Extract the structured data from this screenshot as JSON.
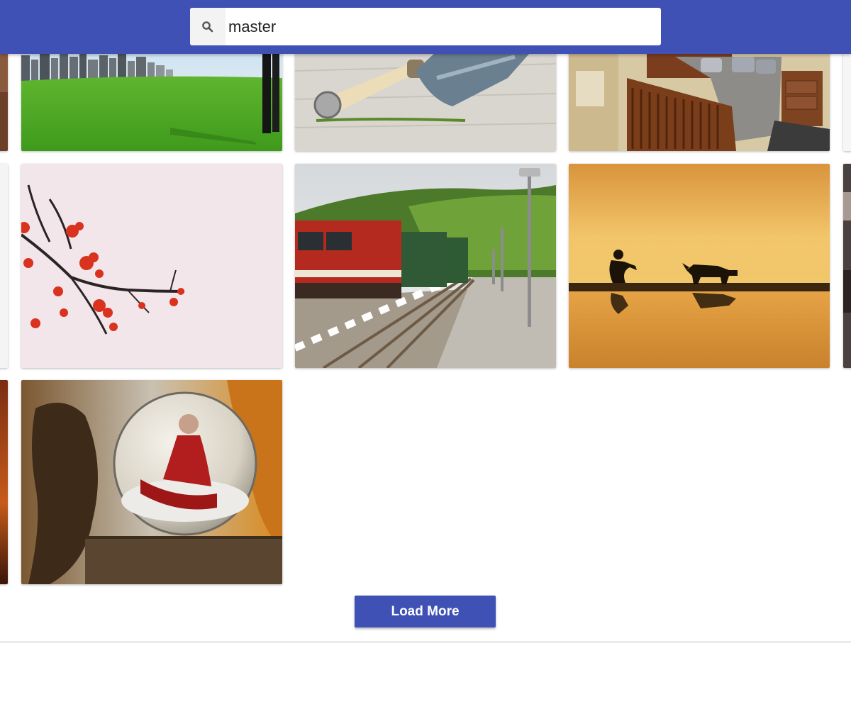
{
  "search": {
    "value": "master",
    "icon": "search-icon"
  },
  "gallery": {
    "load_more_label": "Load More"
  },
  "colors": {
    "header": "#3f51b5",
    "button": "#3f51b5"
  }
}
